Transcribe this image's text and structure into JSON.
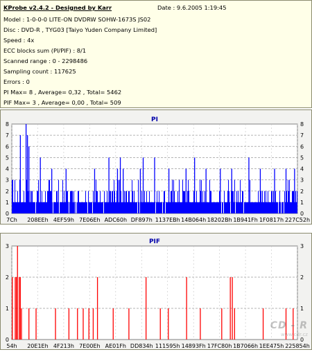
{
  "info": {
    "title": "KProbe v2.4.2 - Designed by Karr",
    "date": "Date : 9.6.2005 1:19:45",
    "lines": [
      "Model : 1-0-0-0 LITE-ON DVDRW SOHW-1673S JS02",
      "Disc : DVD-R , TYG03 [Taiyo Yuden Company Limited]",
      "Speed : 4x",
      "ECC blocks sum (PI/PIF) : 8/1",
      "Scanned range : 0 - 2298486",
      "Sampling count : 117625",
      "Errors : 0",
      "PI Max= 8 , Average= 0,32 , Total= 5462",
      "PIF Max= 3 , Average= 0,00 , Total= 509"
    ]
  },
  "watermark": {
    "logo": "CD - R",
    "text": "www.cdr.cz"
  },
  "chart_data": [
    {
      "type": "bar",
      "title": "PI",
      "ylim": [
        0,
        8
      ],
      "yticks": [
        0,
        1,
        2,
        3,
        4,
        5,
        6,
        7,
        8
      ],
      "xticks": [
        "7Ch",
        "208EEh",
        "4EF59h",
        "7E06Eh",
        "ADC60h",
        "DF897h",
        "1137EBh",
        "14B064h",
        "18202Bh",
        "1B941Fh",
        "1F0817h",
        "227C52h"
      ],
      "bar_color": "#0000ff",
      "grid": true,
      "max": 8,
      "average": 0.32,
      "spikes": [
        {
          "x": 0.03,
          "v": 7
        },
        {
          "x": 0.05,
          "v": 8
        },
        {
          "x": 0.055,
          "v": 7
        },
        {
          "x": 0.06,
          "v": 6
        },
        {
          "x": 0.1,
          "v": 5
        },
        {
          "x": 0.14,
          "v": 4
        },
        {
          "x": 0.19,
          "v": 4
        },
        {
          "x": 0.29,
          "v": 4
        },
        {
          "x": 0.34,
          "v": 5
        },
        {
          "x": 0.37,
          "v": 4
        },
        {
          "x": 0.38,
          "v": 5
        },
        {
          "x": 0.39,
          "v": 4
        },
        {
          "x": 0.45,
          "v": 4
        },
        {
          "x": 0.46,
          "v": 5
        },
        {
          "x": 0.5,
          "v": 5
        },
        {
          "x": 0.55,
          "v": 4
        },
        {
          "x": 0.61,
          "v": 4
        },
        {
          "x": 0.64,
          "v": 5
        },
        {
          "x": 0.68,
          "v": 4
        },
        {
          "x": 0.73,
          "v": 4
        },
        {
          "x": 0.77,
          "v": 4
        },
        {
          "x": 0.83,
          "v": 5
        },
        {
          "x": 0.87,
          "v": 4
        },
        {
          "x": 0.92,
          "v": 4
        },
        {
          "x": 0.96,
          "v": 4
        },
        {
          "x": 0.99,
          "v": 4
        }
      ]
    },
    {
      "type": "bar",
      "title": "PIF",
      "ylim": [
        0,
        3
      ],
      "yticks": [
        0,
        1,
        2,
        3
      ],
      "xticks": [
        "54h",
        "20E1Eh",
        "4F213h",
        "7E00Eh",
        "AE01Fh",
        "DD834h",
        "111595h",
        "14893Fh",
        "17FC80h",
        "1B7066h",
        "1EE475h",
        "225854h"
      ],
      "bar_color": "#ff0000",
      "grid": true,
      "max": 3,
      "average": 0.0,
      "bars": [
        {
          "x": 0.002,
          "v": 2
        },
        {
          "x": 0.012,
          "v": 2
        },
        {
          "x": 0.016,
          "v": 2
        },
        {
          "x": 0.02,
          "v": 3
        },
        {
          "x": 0.026,
          "v": 2
        },
        {
          "x": 0.03,
          "v": 2
        },
        {
          "x": 0.034,
          "v": 1
        },
        {
          "x": 0.06,
          "v": 1
        },
        {
          "x": 0.085,
          "v": 1
        },
        {
          "x": 0.153,
          "v": 1
        },
        {
          "x": 0.2,
          "v": 1
        },
        {
          "x": 0.23,
          "v": 1
        },
        {
          "x": 0.25,
          "v": 1
        },
        {
          "x": 0.27,
          "v": 1
        },
        {
          "x": 0.285,
          "v": 1
        },
        {
          "x": 0.3,
          "v": 2
        },
        {
          "x": 0.355,
          "v": 1
        },
        {
          "x": 0.41,
          "v": 1
        },
        {
          "x": 0.47,
          "v": 2
        },
        {
          "x": 0.52,
          "v": 1
        },
        {
          "x": 0.548,
          "v": 1
        },
        {
          "x": 0.612,
          "v": 2
        },
        {
          "x": 0.66,
          "v": 1
        },
        {
          "x": 0.735,
          "v": 1
        },
        {
          "x": 0.765,
          "v": 2
        },
        {
          "x": 0.772,
          "v": 2
        },
        {
          "x": 0.78,
          "v": 1
        },
        {
          "x": 0.88,
          "v": 1
        },
        {
          "x": 0.96,
          "v": 1
        },
        {
          "x": 0.985,
          "v": 1
        }
      ]
    }
  ]
}
